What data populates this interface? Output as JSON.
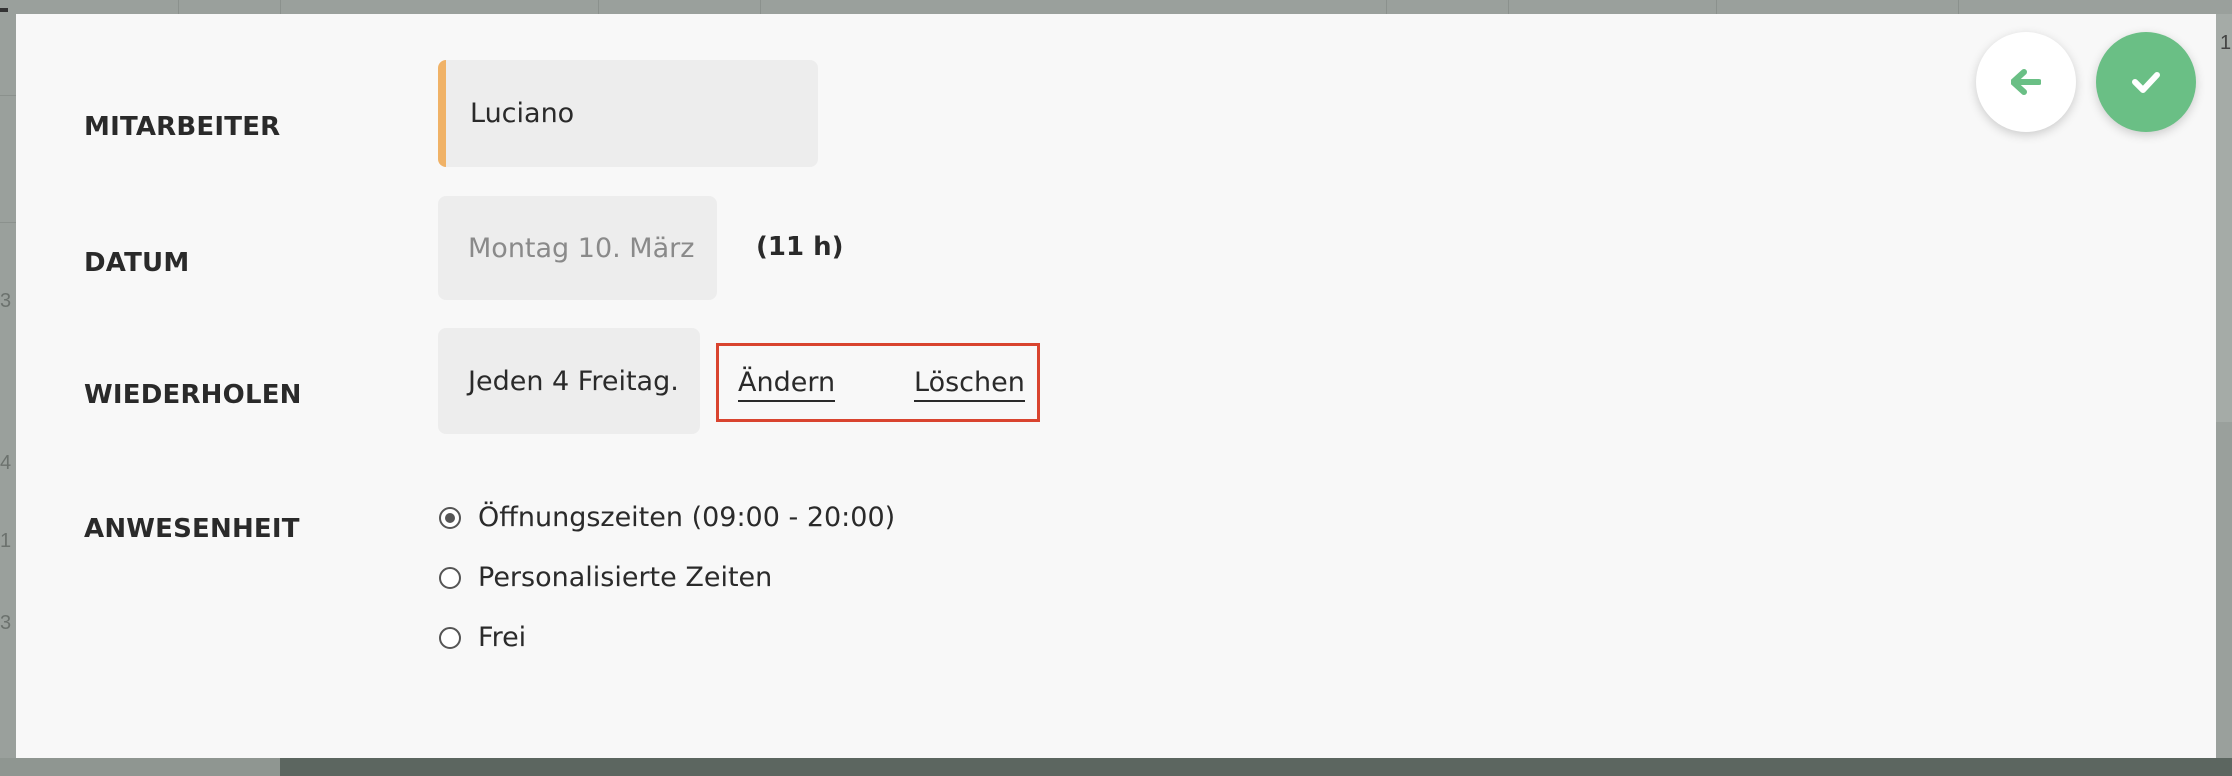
{
  "form": {
    "employee": {
      "label": "MITARBEITER",
      "value": "Luciano"
    },
    "date": {
      "label": "DATUM",
      "value": "Montag 10. März",
      "hours": "(11 h)"
    },
    "repeat": {
      "label": "WIEDERHOLEN",
      "value": "Jeden 4 Freitag.",
      "change_label": "Ändern",
      "delete_label": "Löschen"
    },
    "presence": {
      "label": "ANWESENHEIT",
      "options": [
        {
          "label": "Öffnungszeiten (09:00 - 20:00)",
          "checked": true
        },
        {
          "label": "Personalisierte Zeiten",
          "checked": false
        },
        {
          "label": "Frei",
          "checked": false
        }
      ]
    }
  },
  "actions": {
    "back_icon": "arrow-left-icon",
    "confirm_icon": "checkmark-icon"
  },
  "background": {
    "right_edge_number": "1",
    "left_edge_numbers": [
      "3",
      "4",
      "1",
      "3"
    ]
  },
  "colors": {
    "accent_employee": "#f0b267",
    "confirm_green": "#6abf85",
    "highlight_red": "#d9442f"
  }
}
